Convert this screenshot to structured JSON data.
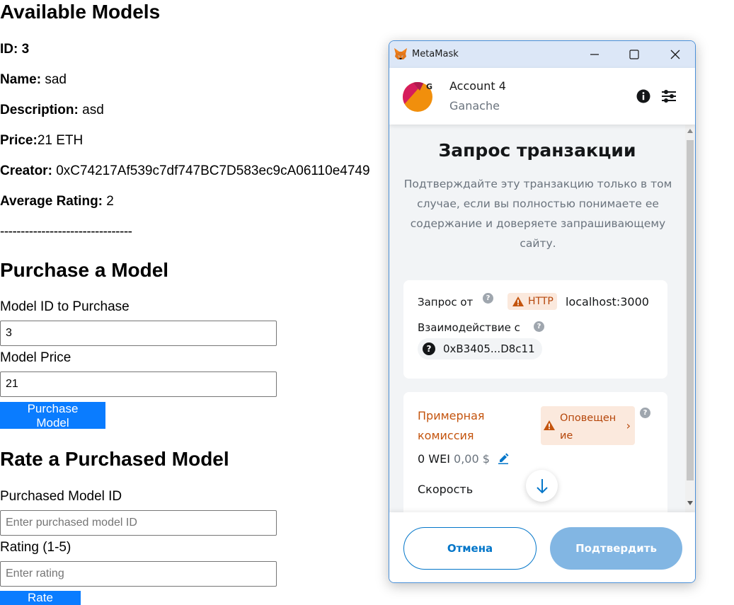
{
  "page": {
    "available_heading": "Available Models",
    "model": {
      "id_label": "ID:",
      "id_value": "3",
      "name_label": "Name:",
      "name_value": "sad",
      "description_label": "Description:",
      "description_value": "asd",
      "price_label": "Price:",
      "price_value": "21 ETH",
      "creator_label": "Creator:",
      "creator_value": "0xC74217Af539c7df747BC7D583ec9cA06110e4749",
      "rating_label": "Average Rating:",
      "rating_value": "2"
    },
    "separator": "--------------------------------",
    "purchase": {
      "heading": "Purchase a Model",
      "model_id_label": "Model ID to Purchase",
      "model_id_value": "3",
      "price_label": "Model Price",
      "price_value": "21",
      "button": "Purchase Model"
    },
    "rate": {
      "heading": "Rate a Purchased Model",
      "model_id_label": "Purchased Model ID",
      "model_id_placeholder": "Enter purchased model ID",
      "rating_label": "Rating (1-5)",
      "rating_placeholder": "Enter rating",
      "button": "Rate Model"
    },
    "button_color": "#0a7cff"
  },
  "metamask": {
    "window_title": "MetaMask",
    "account_name": "Account 4",
    "network": "Ganache",
    "avatar_letter": "G",
    "request_title": "Запрос транзакции",
    "request_description": "Подтверждайте эту транзакцию только в том случае, если вы полностью понимаете ее содержание и доверяете запрашивающему сайту.",
    "request_from_label": "Запрос от",
    "http_badge": "HTTP",
    "origin": "localhost:3000",
    "interaction_label": "Взаимодействие с",
    "contract_address": "0xB3405...D8c11",
    "fee_label": "Примерная комиссия",
    "alert_badge": "Оповещение",
    "fee_value": "0 WEI",
    "fee_usd": "0,00 $",
    "speed_label": "Скорость",
    "cancel_button": "Отмена",
    "confirm_button": "Подтвердить",
    "colors": {
      "primary": "#0376c9",
      "confirm_disabled": "#82b6e3",
      "warning": "#b5460a",
      "warning_bg": "#fbe9dd"
    }
  }
}
